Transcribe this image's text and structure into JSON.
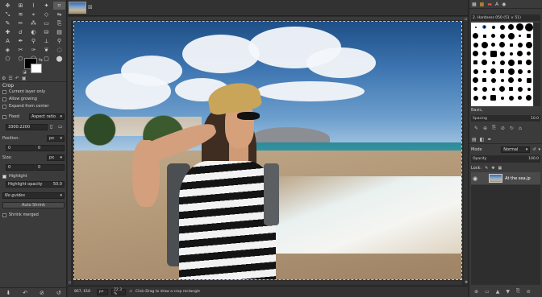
{
  "toolbox": {
    "tools": [
      {
        "name": "move-tool-icon",
        "glyph": "✥"
      },
      {
        "name": "align-tool-icon",
        "glyph": "⊞"
      },
      {
        "name": "free-select-icon",
        "glyph": "⌇"
      },
      {
        "name": "fuzzy-select-icon",
        "glyph": "✦"
      },
      {
        "name": "crop-tool-icon",
        "glyph": "⌗",
        "active": true
      },
      {
        "name": "unified-transform-icon",
        "glyph": "⤡"
      },
      {
        "name": "warp-transform-icon",
        "glyph": "≋"
      },
      {
        "name": "handle-transform-icon",
        "glyph": "⌖"
      },
      {
        "name": "cage-transform-icon",
        "glyph": "◇"
      },
      {
        "name": "flip-tool-icon",
        "glyph": "⇋"
      },
      {
        "name": "paintbrush-icon",
        "glyph": "✎"
      },
      {
        "name": "pencil-icon",
        "glyph": "✏"
      },
      {
        "name": "airbrush-icon",
        "glyph": "⁂"
      },
      {
        "name": "eraser-icon",
        "glyph": "▭"
      },
      {
        "name": "clone-tool-icon",
        "glyph": "⎘"
      },
      {
        "name": "heal-tool-icon",
        "glyph": "✚"
      },
      {
        "name": "smudge-tool-icon",
        "glyph": "☌"
      },
      {
        "name": "dodge-burn-icon",
        "glyph": "◐"
      },
      {
        "name": "bucket-fill-icon",
        "glyph": "⛁"
      },
      {
        "name": "gradient-tool-icon",
        "glyph": "▤"
      },
      {
        "name": "text-tool-icon",
        "glyph": "A"
      },
      {
        "name": "paths-tool-icon",
        "glyph": "✒"
      },
      {
        "name": "color-picker-icon",
        "glyph": "⚲"
      },
      {
        "name": "measure-tool-icon",
        "glyph": "⟂"
      },
      {
        "name": "zoom-tool-icon",
        "glyph": "⚲"
      },
      {
        "name": "foreground-select-icon",
        "glyph": "◈"
      },
      {
        "name": "scissors-select-icon",
        "glyph": "✂"
      },
      {
        "name": "ink-tool-icon",
        "glyph": "✑"
      },
      {
        "name": "mypaint-brush-icon",
        "glyph": "❦"
      },
      {
        "name": "blur-tool-icon",
        "glyph": "◌"
      },
      {
        "name": "perspective-icon",
        "glyph": "⬠"
      },
      {
        "name": "3d-transform-icon",
        "glyph": "⬡"
      },
      {
        "name": "ellipse-select-icon",
        "glyph": "◯"
      },
      {
        "name": "rect-select-icon",
        "glyph": "▢"
      },
      {
        "name": "color-select-icon",
        "glyph": "⬤"
      }
    ]
  },
  "options": {
    "title": "Crop",
    "current_layer_only": "Current layer only",
    "allow_growing": "Allow growing",
    "expand_from_center": "Expand from center",
    "fixed_label": "Fixed",
    "fixed_value": "Aspect ratio",
    "ratio_value": "3300:2200",
    "position_label": "Position:",
    "position_unit": "px",
    "position_x": "0",
    "position_y": "0",
    "size_label": "Size:",
    "size_unit": "px",
    "size_w": "0",
    "size_h": "0",
    "highlight": "Highlight",
    "highlight_opacity_label": "Highlight opacity",
    "highlight_opacity_value": "50.0",
    "guides_value": "No guides",
    "auto_shrink": "Auto Shrink",
    "shrink_merged": "Shrink merged"
  },
  "status": {
    "coords": "867, 618",
    "unit": "px",
    "zoom": "22.3 %",
    "message": "Click-Drag to draw a crop rectangle"
  },
  "brushes": {
    "title": "2. Hardness 050 (51 × 51)",
    "category": "Basic,",
    "spacing_label": "Spacing",
    "spacing_value": "10.0"
  },
  "layers": {
    "mode_label": "Mode",
    "mode_value": "Normal",
    "opacity_label": "Opacity",
    "opacity_value": "100.0",
    "lock_label": "Lock:",
    "layer_name": "At the sea.jp"
  },
  "colors": {
    "foreground": "#000000",
    "background": "#ffffff",
    "selection": "#d8d030"
  }
}
